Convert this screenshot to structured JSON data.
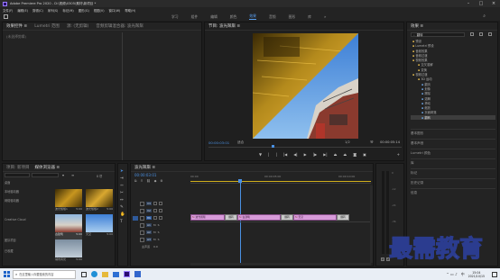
{
  "titlebar": {
    "title": "Adobe Premiere Pro 2020 - D:\\视频\\0305\\素材\\新项目 *"
  },
  "menubar": [
    "文件(F)",
    "编辑(E)",
    "剪辑(C)",
    "序列(S)",
    "标记(M)",
    "图形(G)",
    "视图(V)",
    "窗口(W)",
    "帮助(H)"
  ],
  "workspaces": {
    "items": [
      "学习",
      "组件",
      "编辑",
      "颜色",
      "效果",
      "音频",
      "图形",
      "库"
    ],
    "active": 4
  },
  "effect_controls": {
    "tabs": [
      "效果控件 ≡",
      "Lumetri 范围",
      "源: (无剪辑)",
      "音频剪辑混合器: 波光粼粼"
    ],
    "empty_text": "(未选择剪辑)"
  },
  "program_monitor": {
    "tab": "节目: 波光粼粼 ≡",
    "timecode": "00:00:03:01",
    "fit": "适合",
    "ratio": "1/2",
    "duration": "00:00:05:14"
  },
  "effects_panel": {
    "title": "效果 ≡",
    "search_value": "翻转",
    "tree": [
      "预设",
      "Lumetri 预设",
      "音频效果",
      "音频过渡",
      "视频效果",
      "交叉溶解",
      "变换",
      "视频过渡",
      "3D 运动",
      "翻页",
      "划像",
      "擦除",
      "溶解",
      "滑动",
      "缩放",
      "页面剥落",
      "翻转"
    ],
    "sections": [
      "基本图形",
      "基本声音",
      "Lumetri 颜色",
      "库",
      "标记",
      "历史记录",
      "信息"
    ]
  },
  "project_panel": {
    "tabs": [
      "项目: 新项目",
      "媒体浏览器 ≡"
    ],
    "search_placeholder": "",
    "item_count": "8 项",
    "left_labels": [
      "桌面",
      "本地驱动器",
      "网络驱动器",
      "Creative Cloud",
      "团队项目",
      "已收藏"
    ],
    "thumbs": [
      {
        "name": "波光粼粼1",
        "dur": "5:00"
      },
      {
        "name": "波光粼粼2",
        "dur": "5:00"
      },
      {
        "name": "古建筑",
        "dur": "5:00"
      },
      {
        "name": "天空",
        "dur": "5:00"
      },
      {
        "name": "城市风光",
        "dur": "5:00"
      }
    ]
  },
  "timeline": {
    "tab": "波光粼粼 ≡",
    "timecode": "00:00:03:01",
    "ruler": [
      "00:00",
      "00:00:05:00",
      "00:00:10:00"
    ],
    "tracks": [
      "V3",
      "V2",
      "V1",
      "A1",
      "A2",
      "A3",
      "主声道"
    ],
    "master_value": "0.0",
    "clips": [
      {
        "label": "波光粼粼",
        "fx": "fx"
      },
      {
        "label": "翻转",
        "fx": ""
      },
      {
        "label": "古建筑",
        "fx": "fx"
      },
      {
        "label": "翻转",
        "fx": ""
      },
      {
        "label": "天空",
        "fx": "fx"
      },
      {
        "label": "翻转",
        "fx": ""
      }
    ],
    "meter": [
      "0",
      "-12",
      "-24",
      "-36",
      "-48",
      "dB"
    ]
  },
  "watermark": "最需教育",
  "taskbar": {
    "search_placeholder": "在这里输入你要搜索的内容",
    "time": "15:04",
    "date": "2021/10/15",
    "lang": "中"
  }
}
